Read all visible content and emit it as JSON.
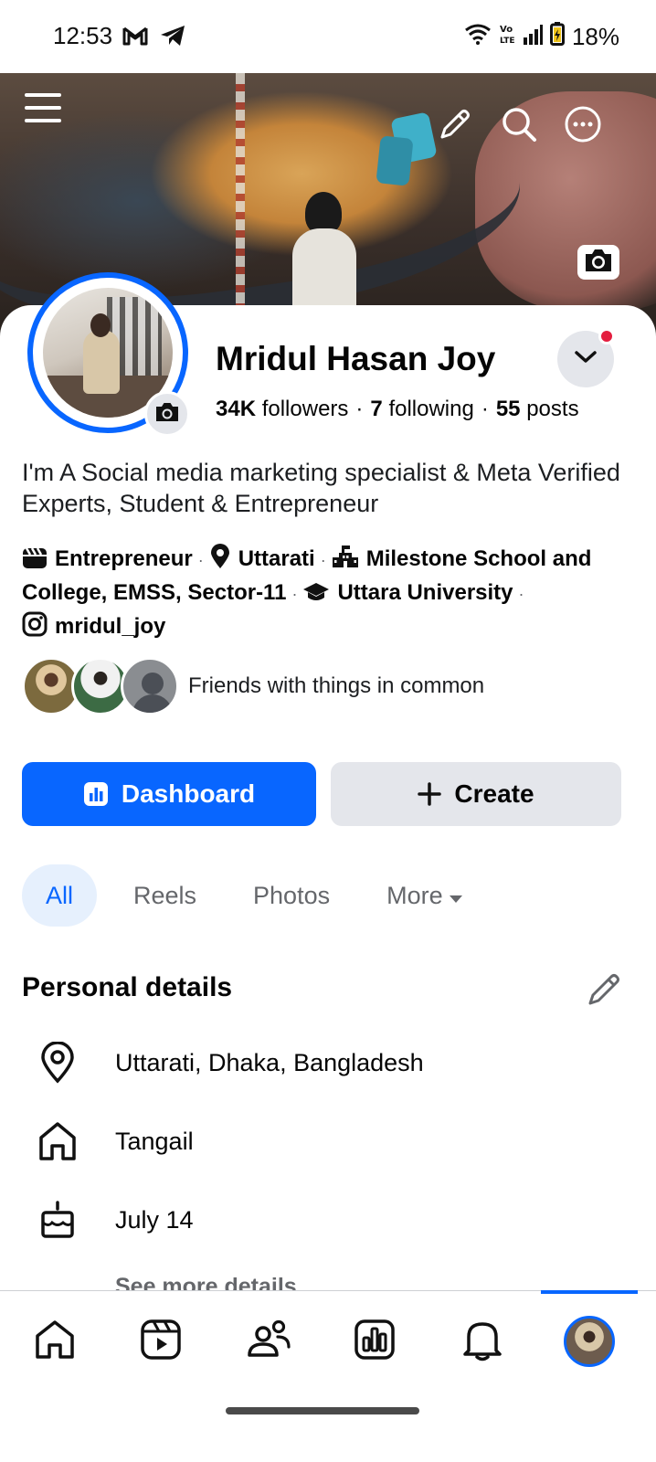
{
  "status_bar": {
    "time": "12:53",
    "battery": "18%",
    "icons": [
      "gmail-icon",
      "telegram-icon",
      "wifi-icon",
      "volte-icon",
      "signal-icon",
      "battery-icon"
    ]
  },
  "cover": {
    "icons": [
      "menu-icon",
      "edit-pencil-icon",
      "search-icon",
      "more-icon",
      "camera-icon"
    ]
  },
  "profile": {
    "name": "Mridul Hasan Joy",
    "followers_count": "34K",
    "followers_label": "followers",
    "following_count": "7",
    "following_label": "following",
    "posts_count": "55",
    "posts_label": "posts",
    "separator": "·",
    "bio": "I'm A Social media marketing specialist & Meta Verified Experts, Student & Entrepreneur"
  },
  "intro": {
    "role": "Entrepreneur",
    "location": "Uttarati",
    "school": "Milestone School and College, EMSS, Sector-11",
    "university": "Uttara University",
    "instagram": "mridul_joy",
    "separator": "·"
  },
  "friends": {
    "text": "Friends with things in common"
  },
  "actions": {
    "dashboard_label": "Dashboard",
    "create_label": "Create"
  },
  "tabs": [
    {
      "label": "All",
      "active": true
    },
    {
      "label": "Reels",
      "active": false
    },
    {
      "label": "Photos",
      "active": false
    },
    {
      "label": "More",
      "active": false
    }
  ],
  "personal_details": {
    "title": "Personal details",
    "items": [
      {
        "icon": "location-pin-icon",
        "text": "Uttarati, Dhaka, Bangladesh"
      },
      {
        "icon": "home-icon",
        "text": "Tangail"
      },
      {
        "icon": "birthday-cake-icon",
        "text": "July 14"
      }
    ],
    "see_more": "See more details"
  },
  "bottom_nav": {
    "items": [
      "home-icon",
      "reels-icon",
      "friends-icon",
      "dashboard-icon",
      "notifications-icon",
      "profile-avatar"
    ],
    "active": "profile-avatar",
    "accent": "#0866ff"
  },
  "colors": {
    "accent": "#0866ff",
    "notification_dot": "#e41e3f",
    "secondary_button": "#e4e6eb",
    "active_tab_bg": "#e6f0fd"
  }
}
